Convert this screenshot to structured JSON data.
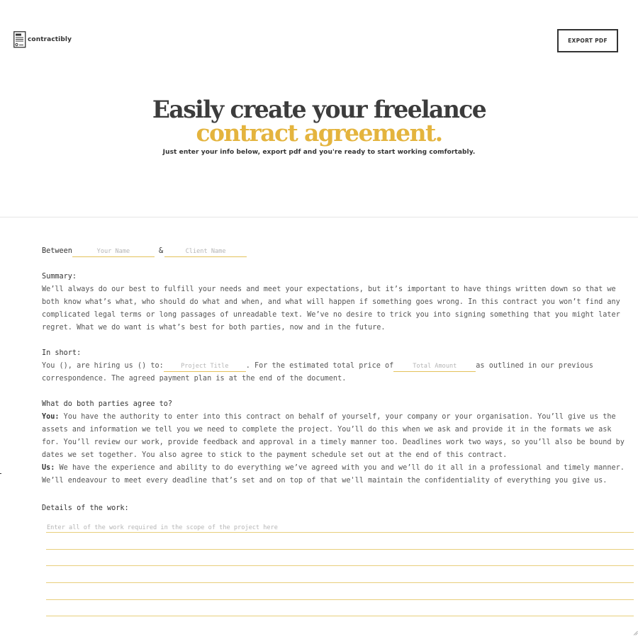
{
  "brand": {
    "name": "contractibly"
  },
  "header": {
    "export_label": "EXPORT PDF"
  },
  "hero": {
    "line1": "Easily create your freelance",
    "line2": "contract agreement.",
    "subtitle": "Just enter your info below, export pdf and you're ready to start working comfortably."
  },
  "between": {
    "label": "Between",
    "your_name_placeholder": "Your Name",
    "amp": "&",
    "client_name_placeholder": "Client Name"
  },
  "summary": {
    "title": "Summary:",
    "text": "We’ll always do our best to fulfill your needs and meet your expectations, but it’s important to have things written down so that we both know what’s what, who should do what and when, and what will happen if something goes wrong. In this contract you won’t find any complicated legal terms or long passages of unreadable text. We’ve no desire to trick you into signing something that you might later regret. What we do want is what’s best for both parties, now and in the future."
  },
  "in_short": {
    "title": "In short:",
    "part1": "You (), are hiring us () to:",
    "project_title_placeholder": "Project Title",
    "part2": ". For the estimated total price of",
    "total_amount_placeholder": "Total Amount",
    "part3": "as outlined in our previous correspondence. The agreed payment plan is at the end of the document."
  },
  "agree": {
    "title": "What do both parties agree to?",
    "you_label": "You:",
    "you_text": " You have the authority to enter into this contract on behalf of yourself, your company or your organisation. You’ll give us the assets and information we tell you we need to complete the project. You’ll do this when we ask and provide it in the formats we ask for. You’ll review our work, provide feedback and approval in a timely manner too. Deadlines work two ways, so you’ll also be bound by dates we set together. You also agree to stick to the payment schedule set out at the end of this contract.",
    "us_label": "Us:",
    "us_text": " We have the experience and ability to do everything we’ve agreed with you and we’ll do it all in a professional and timely manner. We’ll endeavour to meet every deadline that’s set and on top of that we'll maintain the confidentiality of everything you give us."
  },
  "work": {
    "title": "Details of the work:",
    "placeholder": "Enter all of the work required in the scope of the project here"
  },
  "colors": {
    "accent": "#e4b43e",
    "text": "#333333",
    "muted": "#b5b5b5",
    "rule": "#e8cf7c"
  }
}
